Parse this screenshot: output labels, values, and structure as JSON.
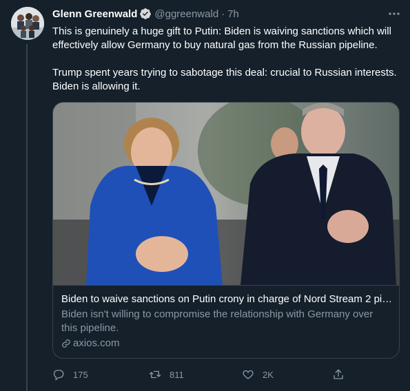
{
  "tweet": {
    "display_name": "Glenn Greenwald",
    "handle": "@ggreenwald",
    "separator": "·",
    "time": "7h",
    "text_paragraphs": [
      "This is genuinely a huge gift to Putin: Biden is waiving sanctions which will effectively allow Germany to buy natural gas from the Russian pipeline.",
      "Trump spent years trying to sabotage this deal: crucial to Russian interests. Biden is allowing it."
    ]
  },
  "card": {
    "title": "Biden to waive sanctions on Putin crony in charge of Nord Stream 2 pi…",
    "description": "Biden isn't willing to compromise the relationship with Germany over this pipeline.",
    "domain": "axios.com"
  },
  "actions": {
    "replies": "175",
    "retweets": "811",
    "likes": "2K"
  },
  "icons": [
    "verified-badge-icon",
    "more-icon",
    "link-icon",
    "reply-icon",
    "retweet-icon",
    "like-icon",
    "share-icon"
  ],
  "colors": {
    "background": "#15202b",
    "text": "#ffffff",
    "secondary_text": "#8b98a5",
    "border": "#38444d",
    "verified": "#1d9bf0"
  }
}
